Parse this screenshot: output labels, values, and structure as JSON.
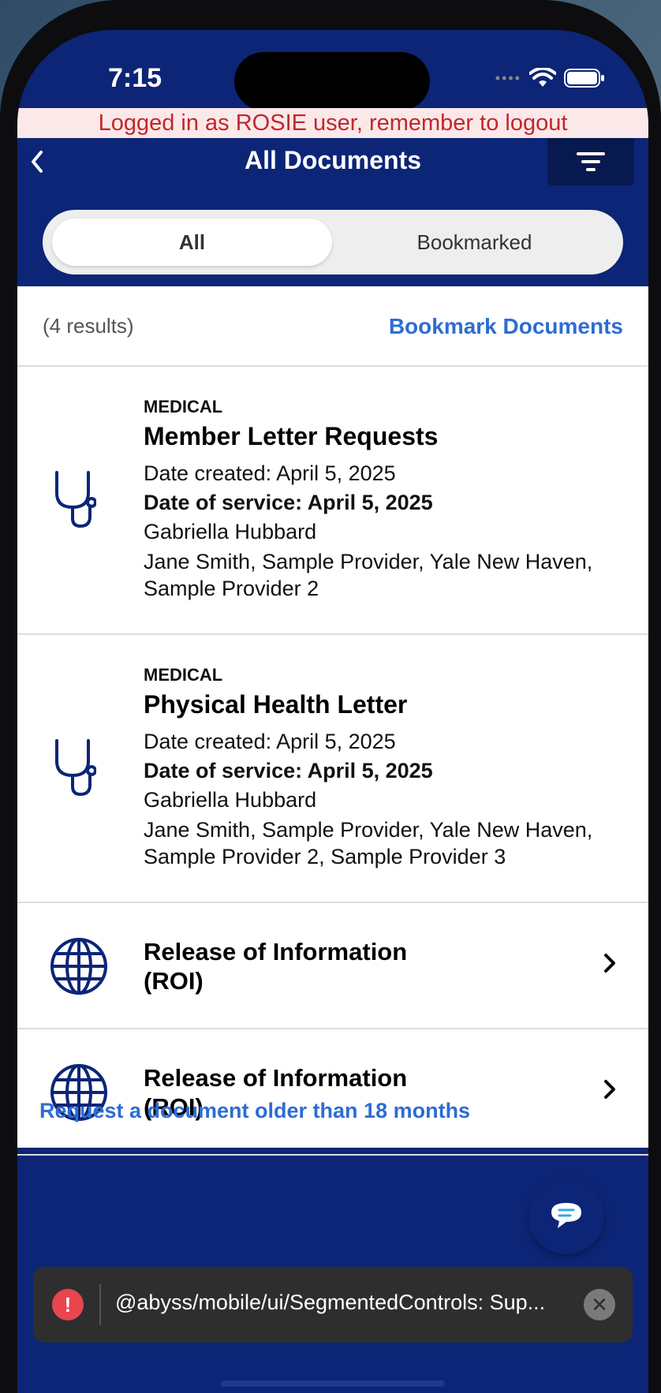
{
  "status_bar": {
    "time": "7:15",
    "signal": "••••"
  },
  "banner": {
    "text": "Logged in as ROSIE user, remember to logout"
  },
  "nav": {
    "back_icon": "chevron-left-icon",
    "title": "All Documents",
    "filter_icon": "filter-icon"
  },
  "segmented": {
    "all": "All",
    "bookmarked": "Bookmarked",
    "selected": "All"
  },
  "results": {
    "count_text": "(4 results)",
    "bookmark_link": "Bookmark Documents"
  },
  "documents": [
    {
      "icon": "stethoscope-icon",
      "category": "MEDICAL",
      "title": "Member Letter Requests",
      "date_created": "Date created: April 5, 2025",
      "date_of_service": "Date of service: April 5, 2025",
      "patient": "Gabriella Hubbard",
      "providers_line1": "Jane Smith, Sample Provider, Yale New Haven,",
      "providers_line2": "Sample Provider 2"
    },
    {
      "icon": "stethoscope-icon",
      "category": "MEDICAL",
      "title": "Physical Health Letter",
      "date_created": "Date created: April 5, 2025",
      "date_of_service": "Date of service: April 5, 2025",
      "patient": "Gabriella Hubbard",
      "providers_line1": "Jane Smith, Sample Provider, Yale New Haven,",
      "providers_line2": "Sample Provider 2, Sample Provider 3"
    },
    {
      "icon": "globe-icon",
      "title_line1": "Release of Information",
      "title_line2": "(ROI)"
    },
    {
      "icon": "globe-icon",
      "title_line1": "Release of Information",
      "title_line2": "(ROI)"
    }
  ],
  "footer": {
    "request_link": "Request a document older than 18 months",
    "chat_icon": "chat-bubble-icon"
  },
  "toast": {
    "text": "@abyss/mobile/ui/SegmentedControls: Sup...",
    "icon": "error-icon",
    "close_icon": "close-icon"
  },
  "colors": {
    "brand": "#0c2577",
    "link": "#2d6dd2",
    "banner_text": "#c0272d",
    "banner_bg": "#fbe8e8"
  }
}
